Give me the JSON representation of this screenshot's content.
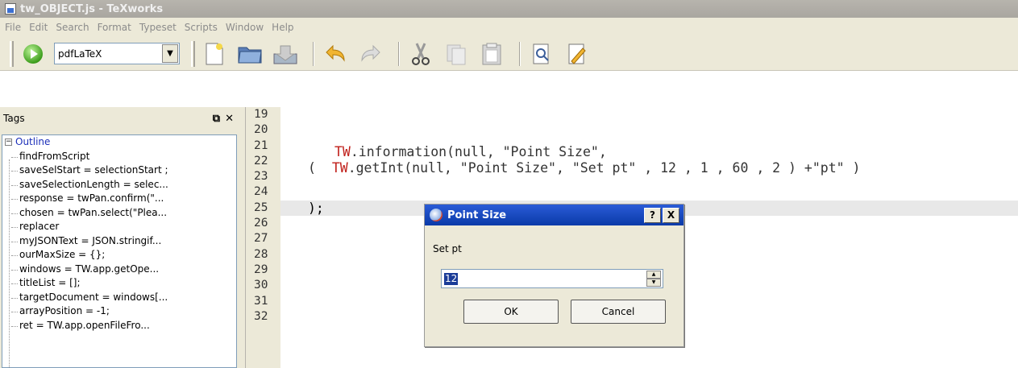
{
  "window": {
    "title": "tw_OBJECT.js - TeXworks"
  },
  "menu": [
    "File",
    "Edit",
    "Search",
    "Format",
    "Typeset",
    "Scripts",
    "Window",
    "Help"
  ],
  "toolbar": {
    "engine": "pdfLaTeX",
    "icons": [
      "typeset-run-icon",
      "new-document-icon",
      "open-folder-icon",
      "save-icon",
      "undo-icon",
      "redo-icon",
      "cut-icon",
      "copy-icon",
      "paste-icon",
      "find-icon",
      "replace-icon"
    ]
  },
  "tags_panel": {
    "title": "Tags",
    "root": "Outline",
    "items": [
      "findFromScript",
      "saveSelStart = selectionStart ;",
      "saveSelectionLength = selec...",
      "response = twPan.confirm(\"...",
      "chosen = twPan.select(\"Plea...",
      "replacer",
      "myJSONText = JSON.stringif...",
      "ourMaxSize = {};",
      "windows =  TW.app.getOpe...",
      "titleList = [];",
      "targetDocument = windows[...",
      "arrayPosition = -1;",
      "  ret =  TW.app.openFileFro..."
    ]
  },
  "editor": {
    "line_numbers": [
      "19",
      "20",
      "21",
      "22",
      "23",
      "24",
      "25",
      "26",
      "27",
      "28",
      "29",
      "30",
      "31",
      "32"
    ],
    "line21": {
      "obj": "TW",
      "rest": ".information(null, \"Point Size\","
    },
    "line22": {
      "pre": "(  ",
      "obj": "TW",
      "rest": ".getInt(null, \"Point Size\", \"Set pt\" , 12 , 1 , 60 , 2 ) +\"pt\" )"
    },
    "line24": ");"
  },
  "dialog": {
    "title": "Point Size",
    "help": "?",
    "close": "X",
    "label": "Set pt",
    "value": "12",
    "ok": "OK",
    "cancel": "Cancel"
  }
}
